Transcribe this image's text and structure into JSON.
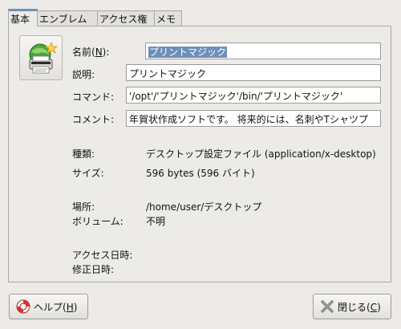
{
  "tabs": [
    {
      "label": "基本"
    },
    {
      "label": "エンブレム"
    },
    {
      "label": "アクセス権"
    },
    {
      "label": "メモ"
    }
  ],
  "fields": {
    "name": {
      "label_prefix": "名前(",
      "label_key": "N",
      "label_suffix": "):",
      "value": "プリントマジック"
    },
    "description": {
      "label": "説明:",
      "value": "プリントマジック"
    },
    "command": {
      "label": "コマンド:",
      "value": "'/opt'/'プリントマジック'/bin/'プリントマジック'"
    },
    "comment": {
      "label": "コメント:",
      "value": "年賀状作成ソフトです。 将来的には、名刺やTシャツプ"
    }
  },
  "info": {
    "type": {
      "label": "種類:",
      "value": "デスクトップ設定ファイル (application/x-desktop)"
    },
    "size": {
      "label": "サイズ:",
      "value": "596 bytes (596 バイト)"
    },
    "location": {
      "label": "場所:",
      "value": "/home/user/デスクトップ"
    },
    "volume": {
      "label": "ボリューム:",
      "value": "不明"
    },
    "accessed": {
      "label": "アクセス日時:",
      "value": ""
    },
    "modified": {
      "label": "修正日時:",
      "value": ""
    }
  },
  "buttons": {
    "help": {
      "prefix": "ヘルプ(",
      "key": "H",
      "suffix": ")",
      "icon": "lifebuoy-icon"
    },
    "close": {
      "prefix": "閉じる(",
      "key": "C",
      "suffix": ")",
      "icon": "close-x-icon"
    }
  },
  "file_icon": "printer-magic-icon",
  "colors": {
    "accent": "#6e8fb8",
    "background": "#ecebe8"
  }
}
